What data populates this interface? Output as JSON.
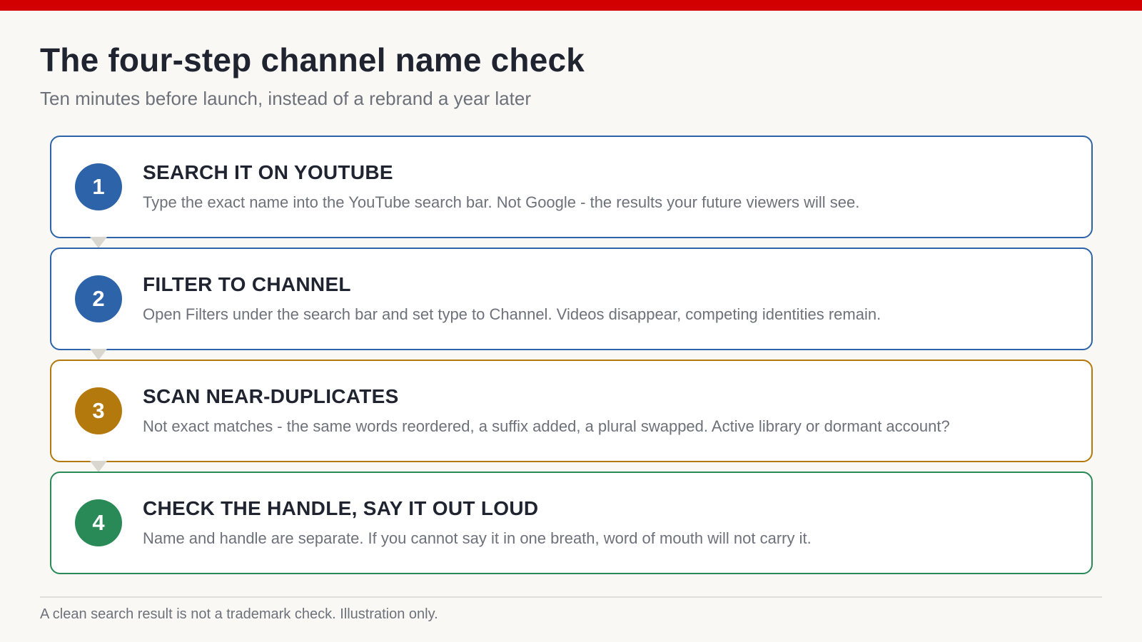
{
  "header": {
    "accent_bar_color": "#d20000",
    "title": "The four-step channel name check",
    "subtitle": "Ten minutes before launch, instead of a rebrand a year later"
  },
  "steps": [
    {
      "number": "1",
      "title": "SEARCH IT ON YOUTUBE",
      "description": "Type the exact name into the YouTube search bar. Not Google - the results your future viewers will see.",
      "color": "#2d63a8"
    },
    {
      "number": "2",
      "title": "FILTER TO CHANNEL",
      "description": "Open Filters under the search bar and set type to Channel. Videos disappear, competing identities remain.",
      "color": "#2d63a8"
    },
    {
      "number": "3",
      "title": "SCAN NEAR-DUPLICATES",
      "description": "Not exact matches - the same words reordered, a suffix added, a plural swapped. Active library or dormant account?",
      "color": "#b3790d"
    },
    {
      "number": "4",
      "title": "CHECK THE HANDLE, SAY IT OUT LOUD",
      "description": "Name and handle are separate. If you cannot say it in one breath, word of mouth will not carry it.",
      "color": "#2a8a57"
    }
  ],
  "footer": {
    "note": "A clean search result is not a trademark check. Illustration only."
  }
}
